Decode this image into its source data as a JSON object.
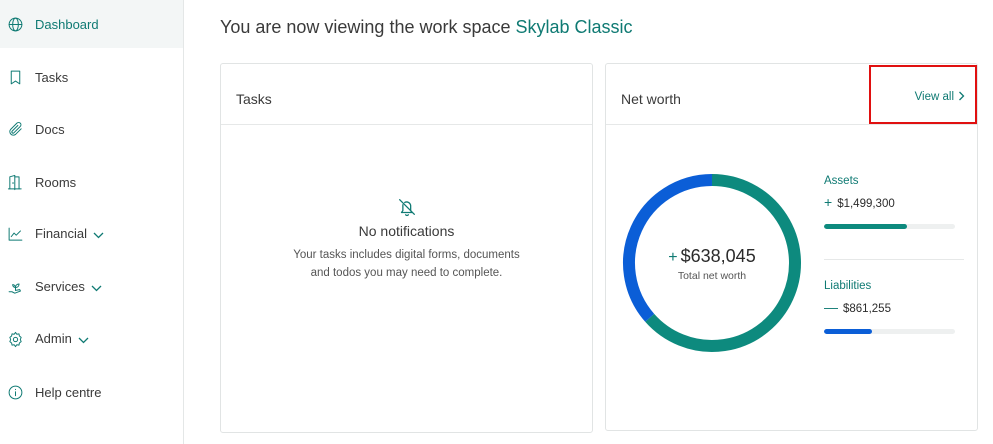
{
  "sidebar": {
    "items": [
      {
        "label": "Dashboard",
        "icon": "globe-icon",
        "active": true,
        "has_chevron": false
      },
      {
        "label": "Tasks",
        "icon": "bookmark-icon",
        "active": false,
        "has_chevron": false
      },
      {
        "label": "Docs",
        "icon": "paperclip-icon",
        "active": false,
        "has_chevron": false
      },
      {
        "label": "Rooms",
        "icon": "door-icon",
        "active": false,
        "has_chevron": false
      },
      {
        "label": "Financial",
        "icon": "chart-line-icon",
        "active": false,
        "has_chevron": true
      },
      {
        "label": "Services",
        "icon": "hand-plant-icon",
        "active": false,
        "has_chevron": true
      },
      {
        "label": "Admin",
        "icon": "gear-icon",
        "active": false,
        "has_chevron": true
      },
      {
        "label": "Help centre",
        "icon": "info-icon",
        "active": false,
        "has_chevron": false
      }
    ]
  },
  "heading": {
    "prefix": "You are now viewing the work space ",
    "workspace": "Skylab Classic"
  },
  "tasks_card": {
    "title": "Tasks",
    "empty_icon": "bell-off-icon",
    "empty_title": "No notifications",
    "empty_desc": "Your tasks includes digital forms, documents and todos you may need to complete."
  },
  "net_worth_card": {
    "title": "Net worth",
    "view_all": "View all",
    "total_sign": "+",
    "total_value": "$638,045",
    "total_label": "Total net worth",
    "assets": {
      "label": "Assets",
      "sign": "+",
      "value": "$1,499,300",
      "amount": 1499300,
      "bar_fraction": 0.63
    },
    "liabilities": {
      "label": "Liabilities",
      "sign": "—",
      "value": "$861,255",
      "amount": 861255,
      "bar_fraction": 0.37
    },
    "colors": {
      "assets": "#0d8a7e",
      "liabilities": "#0b5ed7",
      "accent": "#0f7a73"
    }
  }
}
